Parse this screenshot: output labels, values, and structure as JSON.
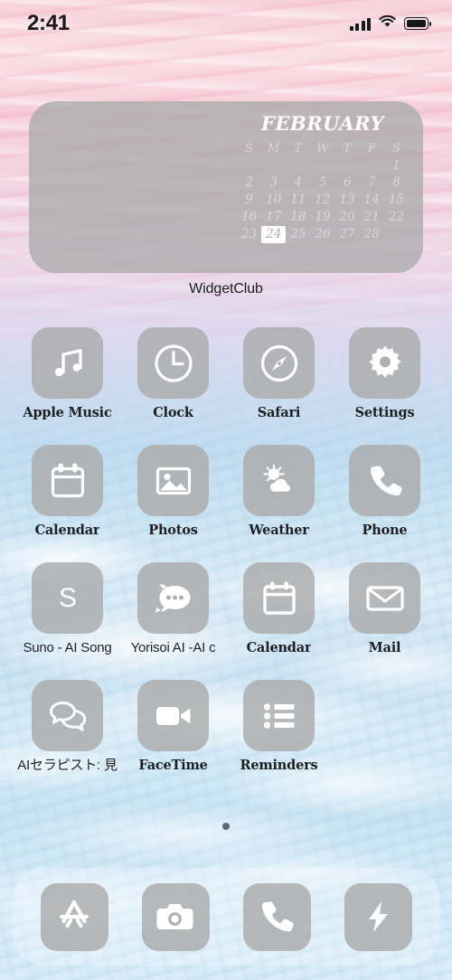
{
  "status_bar": {
    "time": "2:41",
    "signal_icon": "cellular-signal-icon",
    "signal_bars": 4,
    "wifi_icon": "wifi-icon",
    "battery_icon": "battery-full-icon",
    "battery_level": 100
  },
  "widget": {
    "label": "WidgetClub",
    "month": "FEBRUARY",
    "weekdays": [
      "S",
      "M",
      "T",
      "W",
      "T",
      "F",
      "S"
    ],
    "leading_blanks": 6,
    "days": [
      1,
      2,
      3,
      4,
      5,
      6,
      7,
      8,
      9,
      10,
      11,
      12,
      13,
      14,
      15,
      16,
      17,
      18,
      19,
      20,
      21,
      22,
      23,
      24,
      25,
      26,
      27,
      28
    ],
    "today": 24,
    "widget_bg_color": "#aaaaaa",
    "today_highlight_color": "#ffffff"
  },
  "home_grid": {
    "rows": [
      {
        "apps": [
          {
            "label": "Apple Music",
            "icon": "music-note-icon",
            "label_style": "slab"
          },
          {
            "label": "Clock",
            "icon": "clock-icon",
            "label_style": "slab"
          },
          {
            "label": "Safari",
            "icon": "compass-icon",
            "label_style": "slab"
          },
          {
            "label": "Settings",
            "icon": "gear-icon",
            "label_style": "slab"
          }
        ]
      },
      {
        "apps": [
          {
            "label": "Calendar",
            "icon": "calendar-icon",
            "label_style": "slab"
          },
          {
            "label": "Photos",
            "icon": "photos-icon",
            "label_style": "slab"
          },
          {
            "label": "Weather",
            "icon": "sun-cloud-icon",
            "label_style": "slab"
          },
          {
            "label": "Phone",
            "icon": "phone-handset-icon",
            "label_style": "slab"
          }
        ]
      },
      {
        "apps": [
          {
            "label": "Suno - AI Song",
            "icon": "letter-s-icon",
            "label_style": "plain"
          },
          {
            "label": "Yorisoi AI -AI c",
            "icon": "rocket-chat-icon",
            "label_style": "plain"
          },
          {
            "label": "Calendar",
            "icon": "calendar-blank-icon",
            "label_style": "slab"
          },
          {
            "label": "Mail",
            "icon": "envelope-icon",
            "label_style": "slab"
          }
        ]
      },
      {
        "apps": [
          {
            "label": "AIセラピスト: 見",
            "icon": "chat-bubbles-icon",
            "label_style": "plain"
          },
          {
            "label": "FaceTime",
            "icon": "video-camera-icon",
            "label_style": "slab"
          },
          {
            "label": "Reminders",
            "icon": "checklist-icon",
            "label_style": "slab"
          }
        ]
      }
    ]
  },
  "page_indicator": {
    "total_pages": 1,
    "current_page": 1
  },
  "dock": {
    "apps": [
      {
        "label": "App Store",
        "icon": "app-store-icon"
      },
      {
        "label": "Camera",
        "icon": "camera-icon"
      },
      {
        "label": "Phone",
        "icon": "phone-handset-icon"
      },
      {
        "label": "Shortcuts",
        "icon": "lightning-bolt-icon"
      }
    ]
  },
  "theme": {
    "icon_tile_color": "#ababab",
    "icon_glyph_color": "#ffffff",
    "label_color": "#1d2023",
    "wallpaper_top_color": "#f7d3dd",
    "wallpaper_bottom_color": "#d9edf9"
  }
}
